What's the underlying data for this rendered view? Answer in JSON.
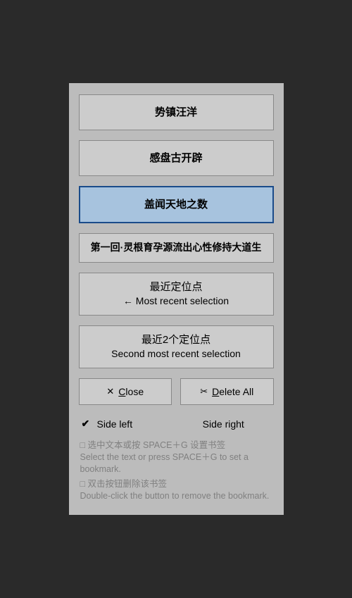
{
  "bookmarks": [
    {
      "label": "势镇汪洋",
      "selected": false
    },
    {
      "label": "感盘古开辟",
      "selected": false
    },
    {
      "label": "盖闻天地之数",
      "selected": true
    },
    {
      "label": "第一回·灵根育孕源流出心性修持大道生",
      "selected": false
    }
  ],
  "recent": [
    {
      "cn": "最近定位点",
      "arrow": "←",
      "en": "Most recent selection"
    },
    {
      "cn": "最近2个定位点",
      "arrow": "",
      "en": "Second most recent selection"
    }
  ],
  "buttons": {
    "close": {
      "icon": "✕",
      "prefix": "C",
      "rest": "lose"
    },
    "deleteAll": {
      "icon": "✂",
      "prefix": "D",
      "rest": "elete All"
    }
  },
  "side": {
    "left": {
      "label": "Side left",
      "checked": true
    },
    "right": {
      "label": "Side right",
      "checked": false
    }
  },
  "hints": [
    {
      "cn": "□ 选中文本或按 SPACE＋G 设置书签",
      "en": "Select the text or press SPACE＋G to set a bookmark."
    },
    {
      "cn": "□ 双击按钮删除该书签",
      "en": "Double-click the button to remove the bookmark."
    }
  ]
}
